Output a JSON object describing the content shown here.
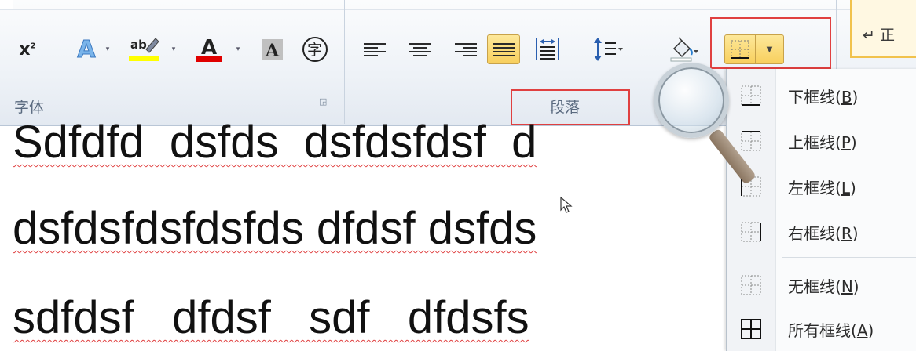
{
  "ribbon": {
    "font_group_label": "字体",
    "paragraph_group_label": "段落",
    "superscript_label": "x",
    "superscript_mark": "2",
    "text_effect_glyph": "A",
    "highlight_glyph": "ab",
    "font_color_glyph": "A",
    "char_shading_glyph": "A",
    "enclosed_char_glyph": "字",
    "right_panel_text": "↵ 正",
    "colors": {
      "highlight": "#ffff00",
      "font_color": "#e00000",
      "active_fill": "#f8cf5d",
      "callout_red": "#e04040"
    }
  },
  "document": {
    "line1": "Sdfdfd  dsfds  dsfdsfdsf  d",
    "line2": "dsfdsfdsfdsfds dfdsf dsfds",
    "line3": "sdfdsf   dfdsf   sdf   dfdsfs"
  },
  "border_menu": {
    "items": [
      {
        "label": "下框线",
        "key": "B",
        "icon": "bottom-border-icon"
      },
      {
        "label": "上框线",
        "key": "P",
        "icon": "top-border-icon"
      },
      {
        "label": "左框线",
        "key": "L",
        "icon": "left-border-icon"
      },
      {
        "label": "右框线",
        "key": "R",
        "icon": "right-border-icon"
      },
      {
        "label": "无框线",
        "key": "N",
        "icon": "no-border-icon"
      },
      {
        "label": "所有框线",
        "key": "A",
        "icon": "all-borders-icon"
      }
    ]
  }
}
